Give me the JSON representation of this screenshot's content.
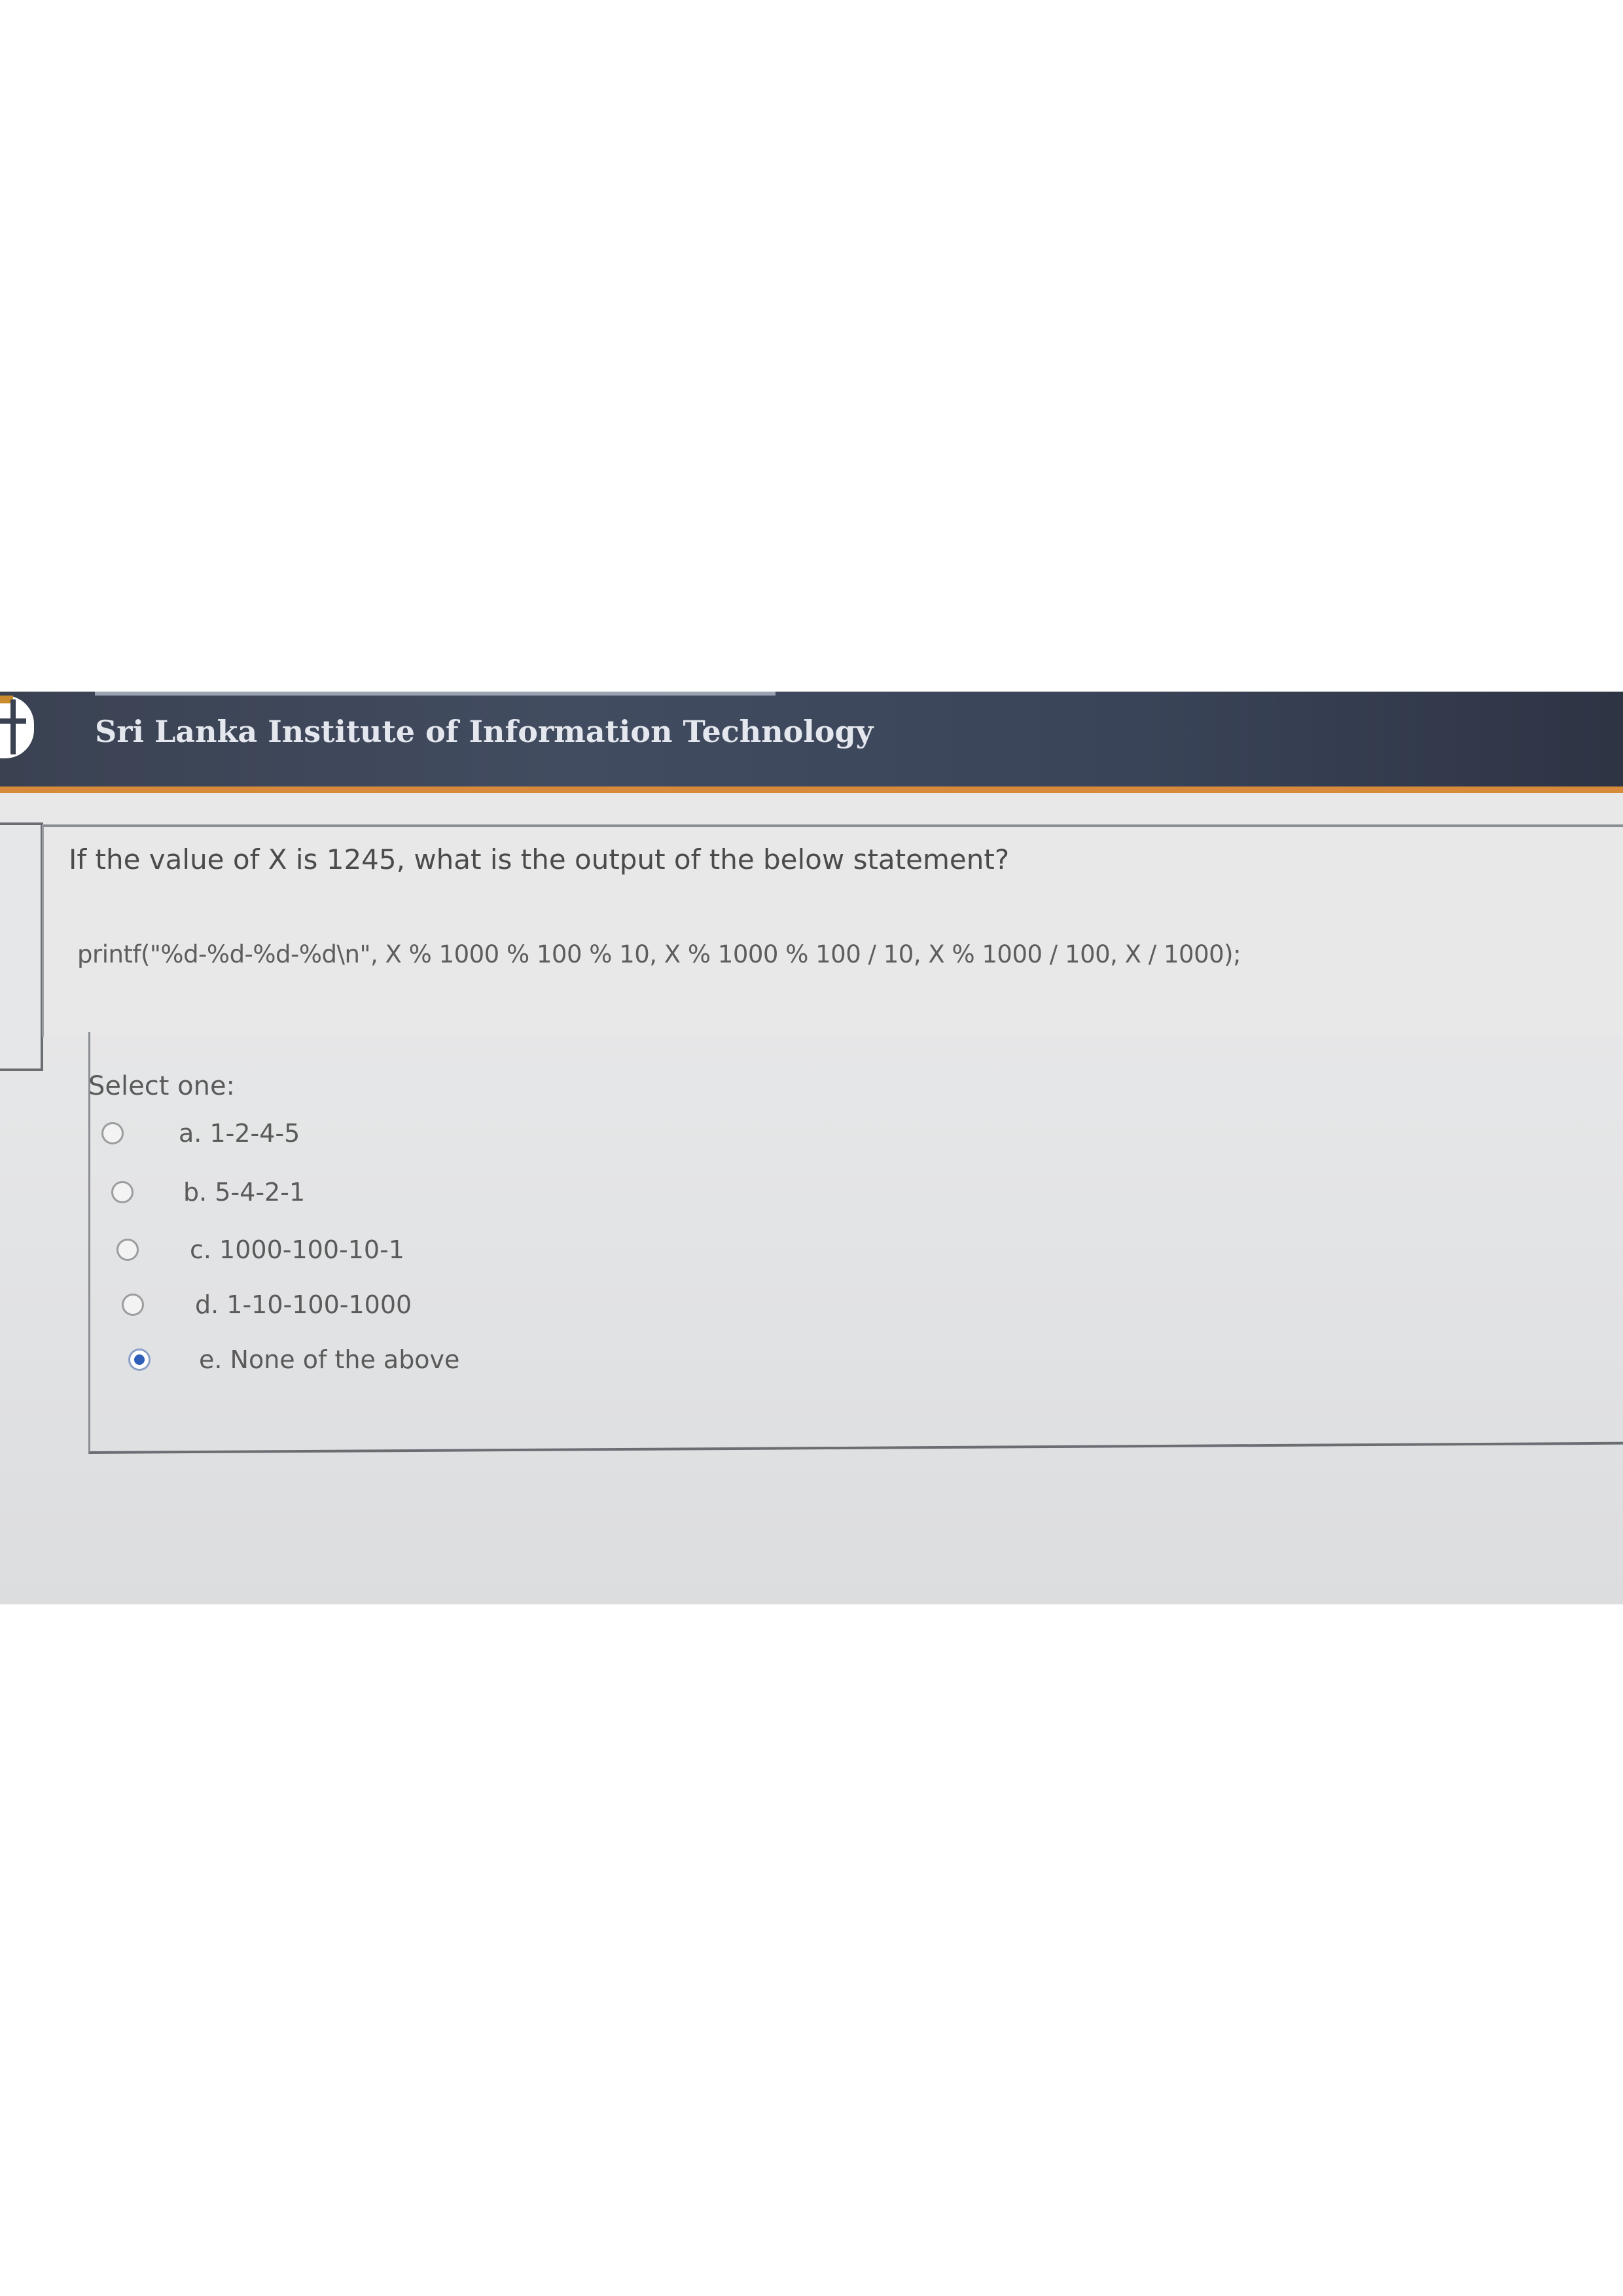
{
  "header": {
    "site_title": "Sri Lanka Institute of Information Technology",
    "accent_color": "#d78a3a",
    "bar_color": "#3a4252"
  },
  "question": {
    "text": "If the value of X is 1245, what is the output of the below statement?",
    "code": "printf(\"%d-%d-%d-%d\\n\", X % 1000 % 100 % 10, X % 1000 % 100 / 10, X % 1000 / 100, X / 1000);"
  },
  "answers": {
    "prompt": "Select one:",
    "options": [
      {
        "label": "a. 1-2-4-5",
        "selected": false
      },
      {
        "label": "b. 5-4-2-1",
        "selected": false
      },
      {
        "label": "c. 1000-100-10-1",
        "selected": false
      },
      {
        "label": "d. 1-10-100-1000",
        "selected": false
      },
      {
        "label": "e. None of the above",
        "selected": true
      }
    ],
    "selected_color": "#2f5fb8"
  }
}
